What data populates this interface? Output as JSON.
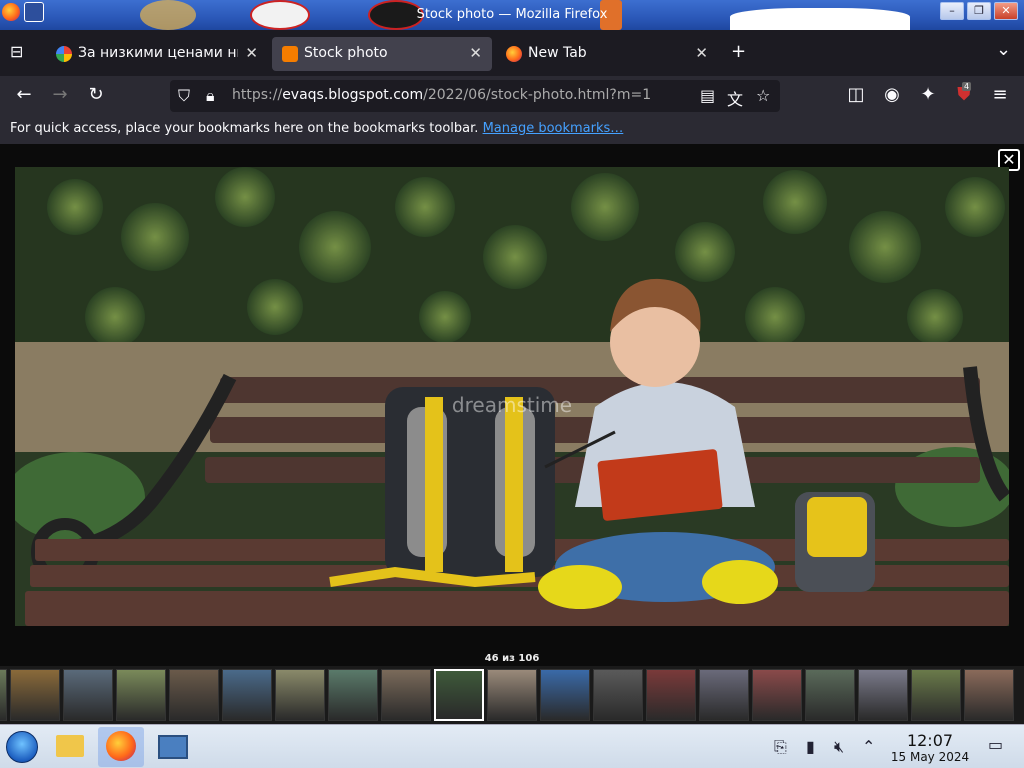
{
  "window": {
    "title": "Stock photo — Mozilla Firefox",
    "buttons": [
      "–",
      "❐",
      "✕"
    ]
  },
  "tabs": [
    {
      "label": "За низкими ценами ни",
      "favicon": "google-icon",
      "active": false
    },
    {
      "label": "Stock photo",
      "favicon": "blogger-icon",
      "active": true
    },
    {
      "label": "New Tab",
      "favicon": "firefox-icon",
      "active": false
    }
  ],
  "tab_icons": {
    "new_tab": "+",
    "list_all": "⌄"
  },
  "nav": {
    "url_prefix": "https://",
    "url_host": "evaqs.blogspot.com",
    "url_path": "/2022/06/stock-photo.html?m=1",
    "extension_badge": "4"
  },
  "bookmarks": {
    "message": "For quick access, place your bookmarks here on the bookmarks toolbar. ",
    "link": "Manage bookmarks…"
  },
  "viewer": {
    "counter": "46 из 106",
    "close_glyph": "✕",
    "watermark": "dreamstime",
    "thumb_count": 20,
    "current_index": 9,
    "colors": {
      "background": "#0b0b0b",
      "thumb_strip": "#1a1a1a"
    }
  },
  "taskbar": {
    "time": "12:07",
    "date": "15 May 2024",
    "colors": {
      "bar": "#dce6f2",
      "active_item": "#8fb0e6"
    }
  },
  "colors": {
    "tab_bar": "#1c1b22",
    "toolbar": "#2b2a33",
    "active_tab": "#42414d",
    "link": "#45a1ff",
    "title_bar": "#2b58b8"
  }
}
